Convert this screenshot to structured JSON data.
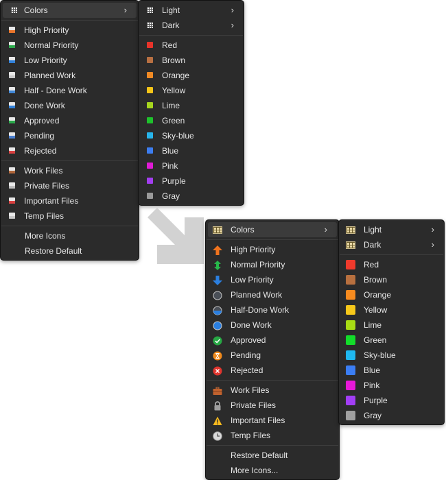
{
  "small_menu": {
    "colors_label": "Colors",
    "items": [
      {
        "label": "High Priority",
        "icon": "high-priority-icon",
        "color": "#e8742a"
      },
      {
        "label": "Normal Priority",
        "icon": "normal-priority-icon",
        "color": "#2aa84a"
      },
      {
        "label": "Low Priority",
        "icon": "low-priority-icon",
        "color": "#2f7fd8"
      },
      {
        "label": "Planned Work",
        "icon": "planned-work-icon",
        "color": "#c9c9c9"
      },
      {
        "label": "Half - Done Work",
        "icon": "half-done-work-icon",
        "color": "#3f86d6"
      },
      {
        "label": "Done Work",
        "icon": "done-work-icon",
        "color": "#2f7fd8"
      },
      {
        "label": "Approved",
        "icon": "approved-icon",
        "color": "#2aa84a"
      },
      {
        "label": "Pending",
        "icon": "pending-icon",
        "color": "#4a7fd0"
      },
      {
        "label": "Rejected",
        "icon": "rejected-icon",
        "color": "#d84040"
      }
    ],
    "files": [
      {
        "label": "Work Files",
        "icon": "work-files-icon",
        "color": "#b0663a"
      },
      {
        "label": "Private Files",
        "icon": "private-files-icon",
        "color": "#bdbdbd"
      },
      {
        "label": "Important Files",
        "icon": "important-files-icon",
        "color": "#d84040"
      },
      {
        "label": "Temp Files",
        "icon": "temp-files-icon",
        "color": "#c9c9c9"
      }
    ],
    "more_icons": "More Icons",
    "restore_default": "Restore Default"
  },
  "small_submenu": {
    "light": "Light",
    "dark": "Dark",
    "colors": [
      {
        "label": "Red",
        "color": "#e8332a"
      },
      {
        "label": "Brown",
        "color": "#b87042"
      },
      {
        "label": "Orange",
        "color": "#f08a24"
      },
      {
        "label": "Yellow",
        "color": "#f5c518"
      },
      {
        "label": "Lime",
        "color": "#a6d61e"
      },
      {
        "label": "Green",
        "color": "#1ec22c"
      },
      {
        "label": "Sky-blue",
        "color": "#27b4ea"
      },
      {
        "label": "Blue",
        "color": "#3c7df0"
      },
      {
        "label": "Pink",
        "color": "#e01ad6"
      },
      {
        "label": "Purple",
        "color": "#a33ef0"
      },
      {
        "label": "Gray",
        "color": "#9a9a9a"
      }
    ]
  },
  "big_menu": {
    "colors_label": "Colors",
    "items": [
      {
        "label": "High Priority",
        "icon": "up-arrow-icon"
      },
      {
        "label": "Normal Priority",
        "icon": "updown-arrow-icon"
      },
      {
        "label": "Low Priority",
        "icon": "down-arrow-icon"
      },
      {
        "label": "Planned Work",
        "icon": "empty-circle-icon"
      },
      {
        "label": "Half-Done Work",
        "icon": "half-circle-icon"
      },
      {
        "label": "Done Work",
        "icon": "blue-circle-icon"
      },
      {
        "label": "Approved",
        "icon": "check-circle-icon"
      },
      {
        "label": "Pending",
        "icon": "hourglass-circle-icon"
      },
      {
        "label": "Rejected",
        "icon": "x-circle-icon"
      }
    ],
    "files": [
      {
        "label": "Work Files",
        "icon": "briefcase-icon"
      },
      {
        "label": "Private Files",
        "icon": "lock-icon"
      },
      {
        "label": "Important Files",
        "icon": "warning-icon"
      },
      {
        "label": "Temp Files",
        "icon": "clock-icon"
      }
    ],
    "restore_default": "Restore Default",
    "more_icons": "More Icons..."
  },
  "big_submenu": {
    "light": "Light",
    "dark": "Dark",
    "colors": [
      {
        "label": "Red",
        "color": "#f03a2c"
      },
      {
        "label": "Brown",
        "color": "#b8703f"
      },
      {
        "label": "Orange",
        "color": "#f78b1f"
      },
      {
        "label": "Yellow",
        "color": "#f7c81a"
      },
      {
        "label": "Lime",
        "color": "#a8dc14"
      },
      {
        "label": "Green",
        "color": "#13dd2a"
      },
      {
        "label": "Sky-blue",
        "color": "#1fb8f0"
      },
      {
        "label": "Blue",
        "color": "#3b7ef5"
      },
      {
        "label": "Pink",
        "color": "#e818d8"
      },
      {
        "label": "Purple",
        "color": "#a23ef5"
      },
      {
        "label": "Gray",
        "color": "#9f9f9f"
      }
    ]
  }
}
